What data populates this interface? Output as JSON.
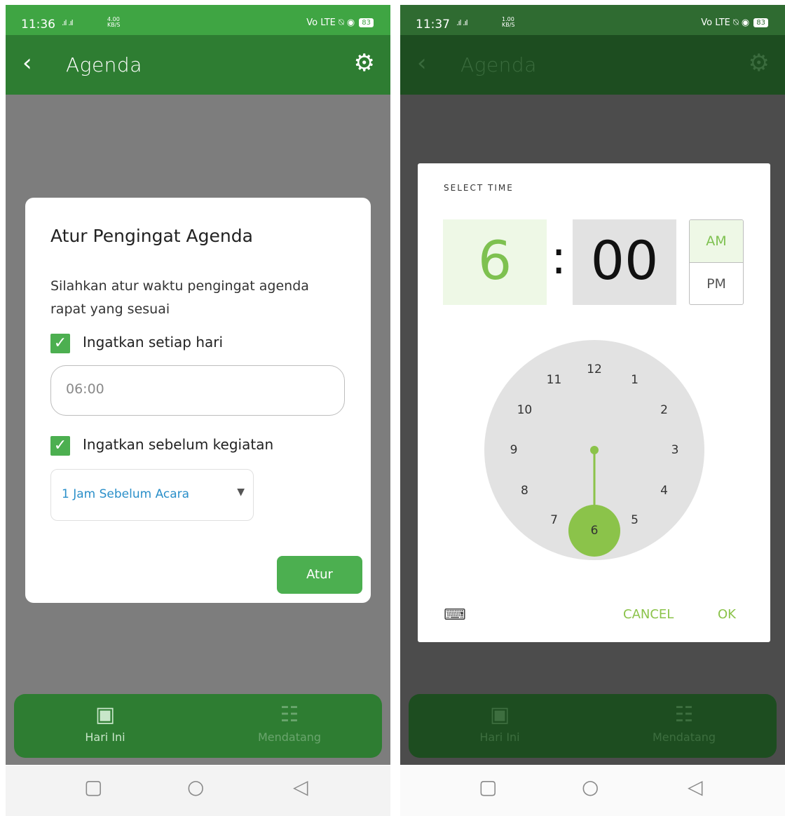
{
  "screen1": {
    "status": {
      "time": "11:36",
      "signal": ".ıl .ıl",
      "speed_value": "4.00",
      "speed_unit": "KB/S",
      "right_icons": "Vo LTE ⍉ ◉",
      "battery": "83"
    },
    "appbar": {
      "title": "Agenda",
      "back_icon": "‹",
      "gear_icon": "⚙"
    },
    "dialog": {
      "title": "Atur Pengingat Agenda",
      "message": "Silahkan atur waktu pengingat agenda rapat yang sesuai",
      "daily_checkbox_label": "Ingatkan setiap hari",
      "daily_checked": true,
      "time_value": "06:00",
      "before_checkbox_label": "Ingatkan sebelum kegiatan",
      "before_checked": true,
      "before_option": "1 Jam Sebelum Acara",
      "submit_label": "Atur"
    },
    "bottom_nav": {
      "today_label": "Hari Ini",
      "upcoming_label": "Mendatang"
    }
  },
  "screen2": {
    "status": {
      "time": "11:37",
      "signal": ".ıl .ıl",
      "speed_value": "1.00",
      "speed_unit": "KB/S",
      "right_icons": "Vo LTE ⍉ ◉",
      "battery": "83"
    },
    "appbar": {
      "title": "Agenda",
      "back_icon": "‹",
      "gear_icon": "⚙"
    },
    "time_picker": {
      "header": "SELECT TIME",
      "hour": "6",
      "separator": ":",
      "minute": "00",
      "am_label": "AM",
      "pm_label": "PM",
      "selected_period": "AM",
      "clock_numbers": [
        "12",
        "1",
        "2",
        "3",
        "4",
        "5",
        "6",
        "7",
        "8",
        "9",
        "10",
        "11"
      ],
      "selected_hour": 6,
      "cancel_label": "CANCEL",
      "ok_label": "OK",
      "accent_color": "#8bc34a"
    },
    "bottom_nav": {
      "today_label": "Hari Ini",
      "upcoming_label": "Mendatang"
    }
  },
  "colors": {
    "primary": "#2e7d32",
    "status": "#3fa543",
    "button": "#4caf50",
    "dropdown_text": "#2a8fc9"
  }
}
